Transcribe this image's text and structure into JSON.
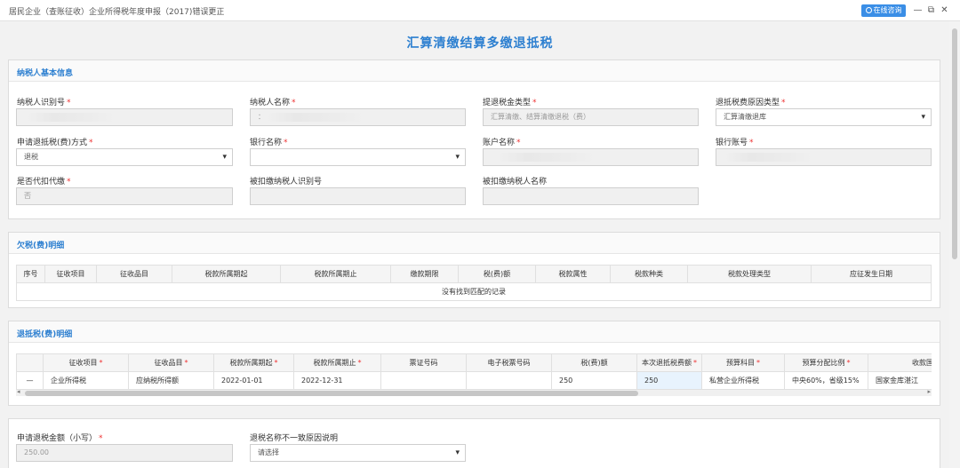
{
  "window": {
    "title": "居民企业（查账征收）企业所得税年度申报（2017)错误更正",
    "online_btn": "在线咨询",
    "minimize": "—",
    "restore": "⧉",
    "close": "✕"
  },
  "page_title": "汇算清缴结算多缴退抵税",
  "section_basic": {
    "title": "纳税人基本信息",
    "fields": {
      "taxpayer_id": {
        "label": "纳税人识别号",
        "value": ""
      },
      "taxpayer_name": {
        "label": "纳税人名称",
        "value": "："
      },
      "refund_type": {
        "label": "提退税金类型",
        "value": "汇算清缴、结算清缴退税（费）"
      },
      "refund_reason": {
        "label": "退抵税费原因类型",
        "value": "汇算清缴退库"
      },
      "apply_method": {
        "label": "申请退抵税(费)方式",
        "value": "退税"
      },
      "bank_name": {
        "label": "银行名称",
        "value": ""
      },
      "account_name": {
        "label": "账户名称",
        "value": ""
      },
      "bank_account": {
        "label": "银行账号",
        "value": ""
      },
      "is_withholding": {
        "label": "是否代扣代缴",
        "value": "否"
      },
      "withheld_id": {
        "label": "被扣缴纳税人识别号",
        "value": ""
      },
      "withheld_name": {
        "label": "被扣缴纳税人名称",
        "value": ""
      }
    }
  },
  "section_arrears": {
    "title": "欠税(费)明细",
    "columns": [
      "序号",
      "征收项目",
      "征收品目",
      "税款所属期起",
      "税款所属期止",
      "缴款期限",
      "税(费)额",
      "税款属性",
      "税款种类",
      "税款处理类型",
      "应征发生日期"
    ],
    "empty_text": "没有找到匹配的记录"
  },
  "section_refund": {
    "title": "退抵税(费)明细",
    "columns": [
      "",
      "征收项目",
      "征收品目",
      "税款所属期起",
      "税款所属期止",
      "票证号码",
      "电子税票号码",
      "税(费)额",
      "本次退抵税费额",
      "预算科目",
      "预算分配比例",
      "收款国库"
    ],
    "required_cols": [
      1,
      2,
      3,
      4,
      8,
      9,
      10
    ],
    "rows": [
      [
        "—",
        "企业所得税",
        "应纳税所得额",
        "2022-01-01",
        "2022-12-31",
        "",
        "",
        "250",
        "250",
        "私营企业所得税",
        "中央60%，省级15%",
        "国家金库湛江"
      ]
    ]
  },
  "section_apply": {
    "amount_label": "申请退税金额（小写）",
    "amount_value": "250.00",
    "reason_label": "退税名称不一致原因说明",
    "reason_value": "请选择"
  },
  "colors": {
    "accent": "#2c7fd0",
    "required": "#e33333"
  }
}
